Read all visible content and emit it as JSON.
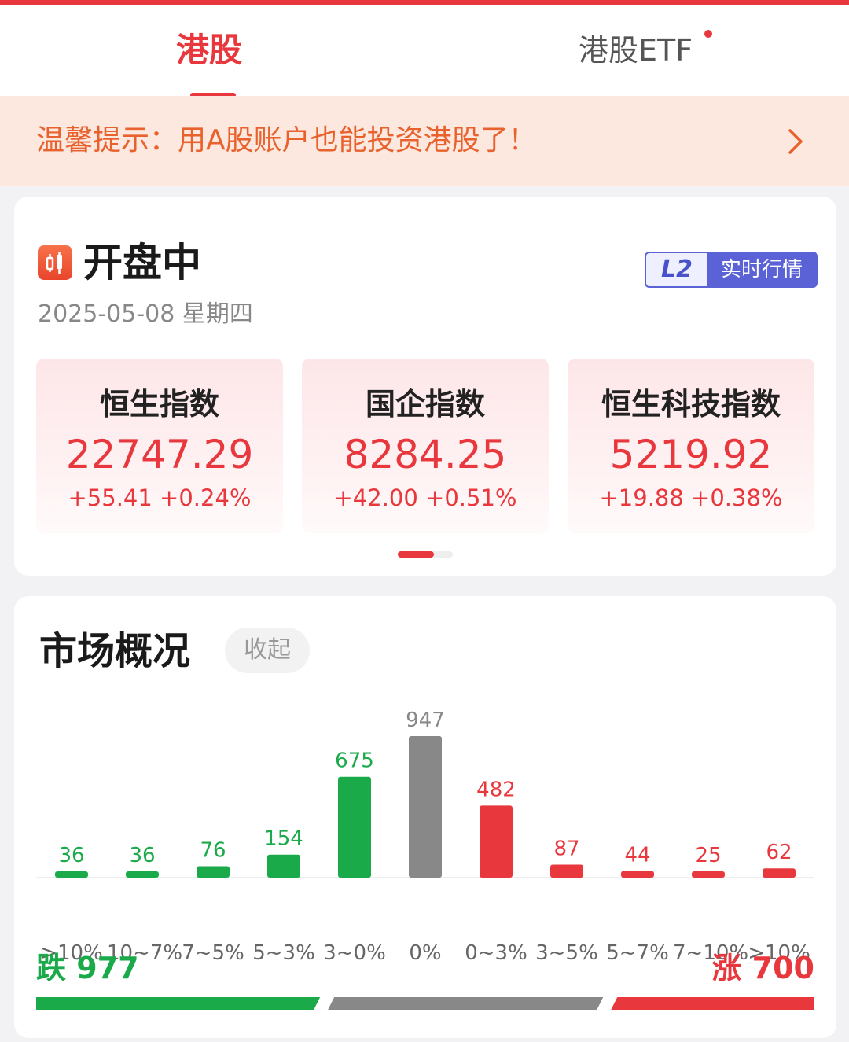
{
  "tabs": [
    {
      "label": "港股",
      "active": true
    },
    {
      "label": "港股ETF",
      "active": false,
      "has_dot": true
    }
  ],
  "tip": {
    "text": "温馨提示：用A股账户也能投资港股了！",
    "arrow_icon": "chevron-right-icon"
  },
  "market_status": {
    "title": "开盘中",
    "date": "2025-05-08 星期四",
    "badge_l2": "L2",
    "badge_text": "实时行情"
  },
  "indices": [
    {
      "name": "恒生指数",
      "value": "22747.29",
      "change": "+55.41",
      "pct": "+0.24%"
    },
    {
      "name": "国企指数",
      "value": "8284.25",
      "change": "+42.00",
      "pct": "+0.51%"
    },
    {
      "name": "恒生科技指数",
      "value": "5219.92",
      "change": "+19.88",
      "pct": "+0.38%"
    }
  ],
  "overview": {
    "title": "市场概况",
    "collapse_label": "收起",
    "down_label": "跌",
    "down_count": "977",
    "up_label": "涨",
    "up_count": "700"
  },
  "colors": {
    "up": "#e8383d",
    "down": "#1aaa4a",
    "flat": "#888888"
  },
  "chart_data": {
    "type": "bar",
    "categories": [
      ">10%",
      "10~7%",
      "7~5%",
      "5~3%",
      "3~0%",
      "0%",
      "0~3%",
      "3~5%",
      "5~7%",
      "7~10%",
      ">10%"
    ],
    "values": [
      36,
      36,
      76,
      154,
      675,
      947,
      482,
      87,
      44,
      25,
      62
    ],
    "bar_colors": [
      "down",
      "down",
      "down",
      "down",
      "down",
      "flat",
      "up",
      "up",
      "up",
      "up",
      "up"
    ],
    "ylim": [
      0,
      947
    ]
  }
}
